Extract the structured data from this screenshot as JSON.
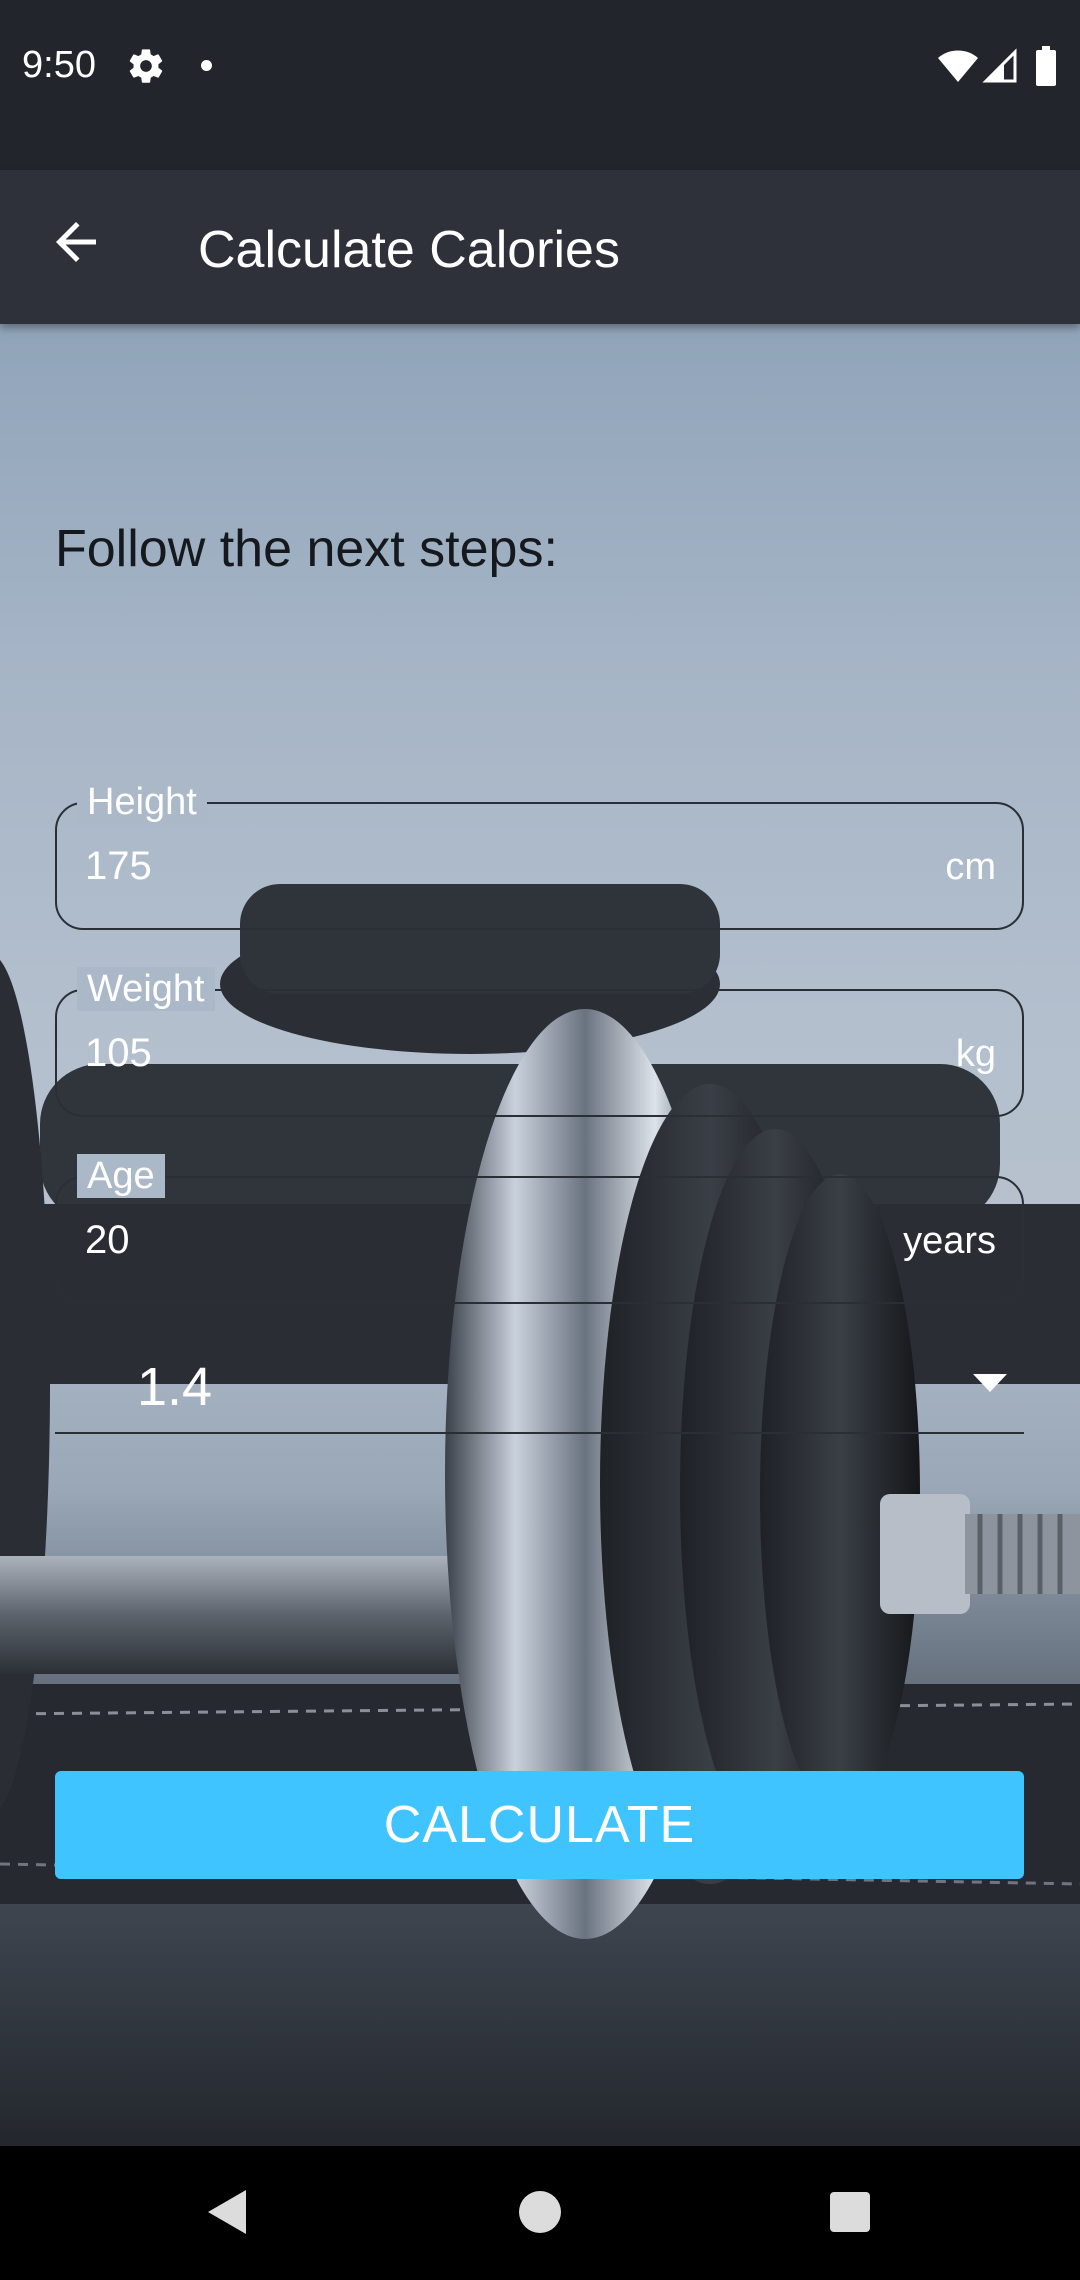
{
  "status_bar": {
    "time": "9:50",
    "icons": [
      "gear-icon",
      "notification-dot-icon",
      "wifi-icon",
      "signal-icon",
      "battery-icon"
    ]
  },
  "app_bar": {
    "title": "Calculate Calories",
    "back_icon": "arrow-back-icon"
  },
  "main": {
    "steps_title": "Follow the next steps:",
    "fields": {
      "height": {
        "label": "Height",
        "value": "175",
        "suffix": "cm"
      },
      "weight": {
        "label": "Weight",
        "value": "105",
        "suffix": "kg"
      },
      "age": {
        "label": "Age",
        "value": "20",
        "suffix": "years"
      }
    },
    "activity_dropdown": {
      "selected": "1.4",
      "icon": "dropdown-arrow-icon"
    },
    "calculate_label": "CALCULATE"
  },
  "nav_bar": {
    "icons": [
      "nav-back-icon",
      "nav-home-icon",
      "nav-recents-icon"
    ]
  },
  "colors": {
    "status_bar": "#22252c",
    "app_bar": "#2e3139",
    "accent_button": "#40c4ff",
    "nav_bar": "#000000"
  }
}
